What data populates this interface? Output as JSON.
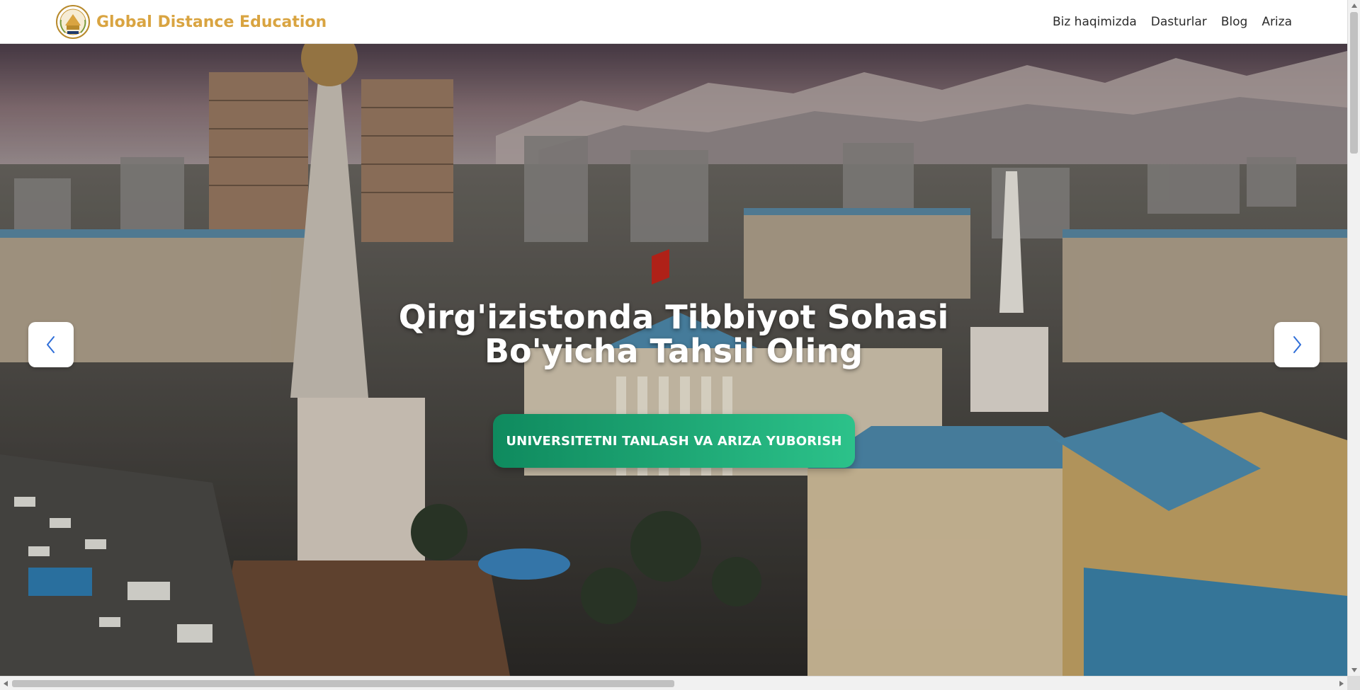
{
  "header": {
    "brand_name": "Global Distance Education",
    "nav": [
      "Biz haqimizda",
      "Dasturlar",
      "Blog",
      "Ariza"
    ]
  },
  "hero": {
    "title_line1": "Qirg'izistonda Tibbiyot Sohasi",
    "title_line2": "Bo'yicha Tahsil Oling",
    "cta_label": "UNIVERSITETNI TANLASH VA ARIZA YUBORISH"
  },
  "colors": {
    "brand": "#d9a441",
    "cta_start": "#0f8a5e",
    "cta_end": "#2cc28a",
    "nav_text": "#2b2b2b",
    "arrow_icon": "#2f6ed8"
  },
  "icons": {
    "logo": "university-crest-logo",
    "prev": "chevron-left-icon",
    "next": "chevron-right-icon"
  }
}
